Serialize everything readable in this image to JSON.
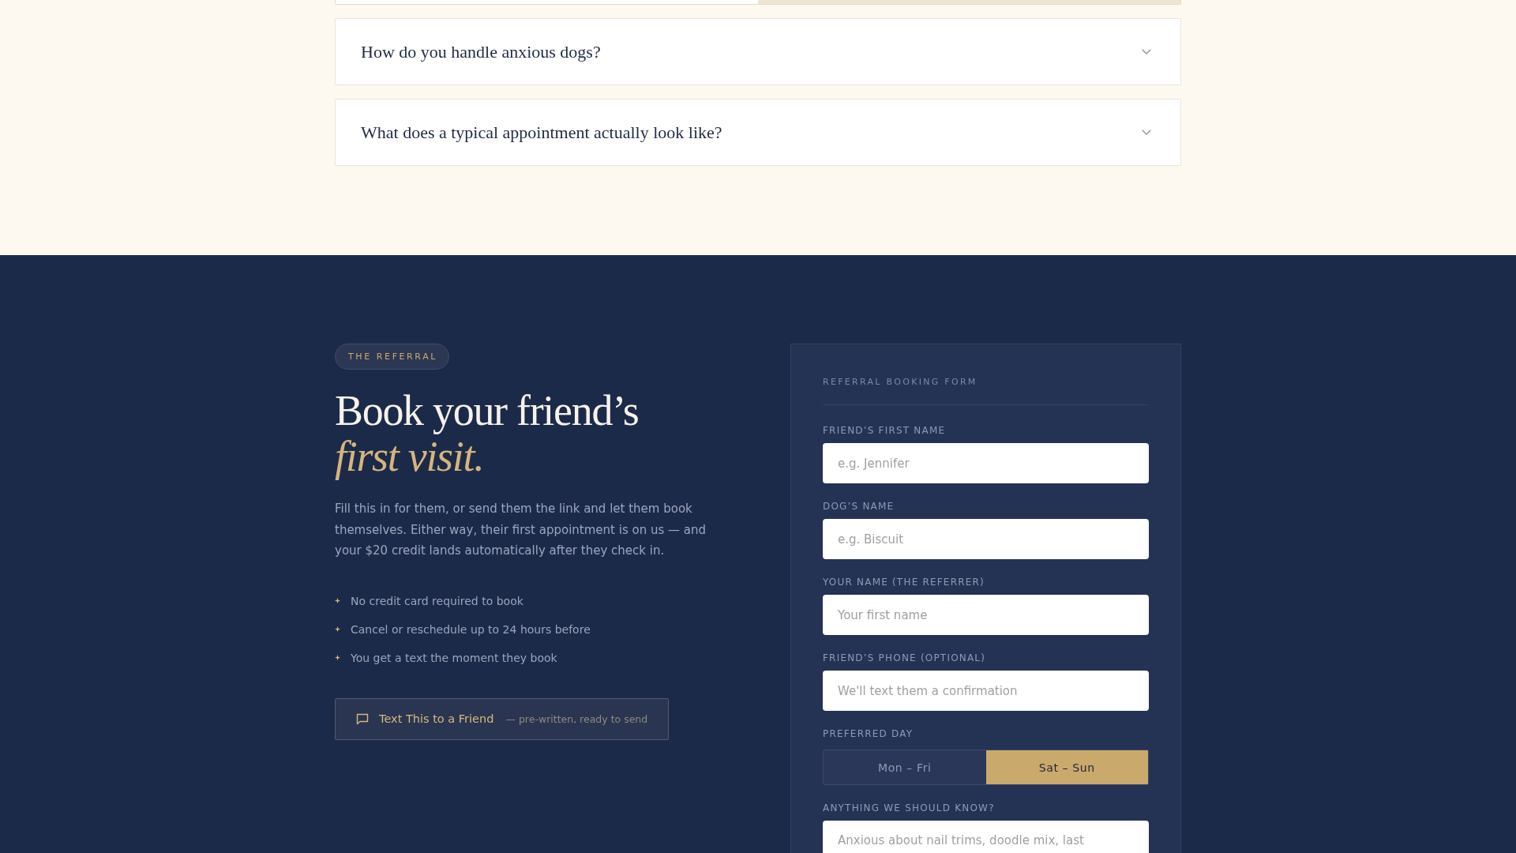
{
  "faq": {
    "items": [
      {
        "question": "How do you handle anxious dogs?",
        "expanded": false
      },
      {
        "question": "What does a typical appointment actually look like?",
        "expanded": false
      }
    ]
  },
  "referral": {
    "badge": "THE REFERRAL",
    "heading": "Book your friend’s",
    "heading_accent": "first visit.",
    "description": "Fill this in for them, or send them the link and let them book themselves. Either way, their first appointment is on us — and your $20 credit lands automatically after they check in.",
    "perks": [
      "No credit card required to book",
      "Cancel or reschedule up to 24 hours before",
      "You get a text the moment they book"
    ],
    "share_button": {
      "label": "Text This to a Friend",
      "note": "— pre-written, ready to send"
    }
  },
  "form": {
    "title": "REFERRAL BOOKING FORM",
    "fields": [
      {
        "kind": "text",
        "label": "FRIEND’S FIRST NAME",
        "placeholder": "e.g. Jennifer"
      },
      {
        "kind": "text",
        "label": "DOG’S NAME",
        "placeholder": "e.g. Biscuit"
      },
      {
        "kind": "text",
        "label": "YOUR NAME (THE REFERRER)",
        "placeholder": "Your first name"
      },
      {
        "kind": "text",
        "label": "FRIEND’S PHONE (OPTIONAL)",
        "placeholder": "We'll text them a confirmation"
      },
      {
        "kind": "choice",
        "label": "PREFERRED DAY",
        "options": [
          {
            "label": "Mon – Fri",
            "selected": false
          },
          {
            "label": "Sat – Sun",
            "selected": true
          }
        ]
      },
      {
        "kind": "textarea",
        "label": "ANYTHING WE SHOULD KNOW?",
        "placeholder": "Anxious about nail trims, doodle mix, last"
      }
    ]
  }
}
